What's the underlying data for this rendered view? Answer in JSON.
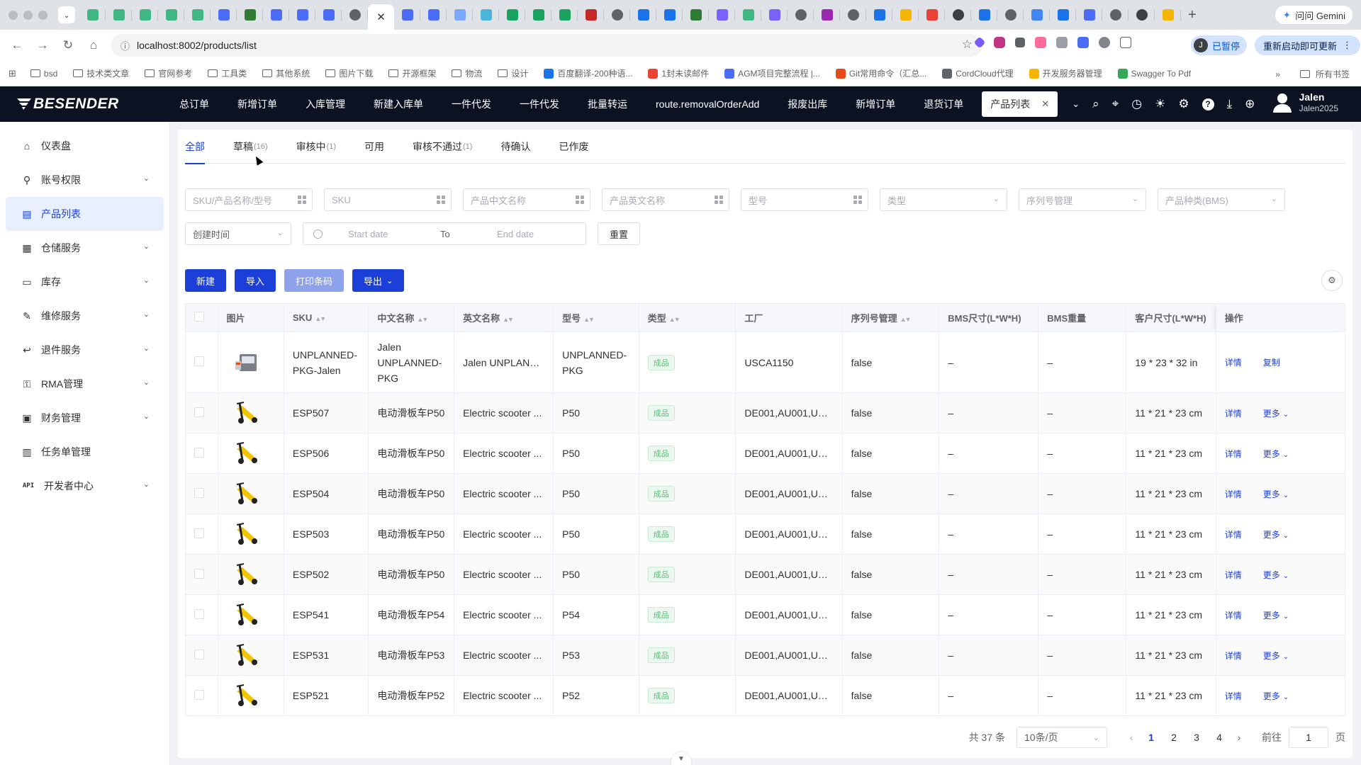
{
  "browser": {
    "url": "localhost:8002/products/list",
    "gemini_label": "问问 Gemini",
    "paused_avatar": "J",
    "paused_label": "已暂停",
    "restart_label": "重新启动即可更新",
    "bookmarks": [
      {
        "label": "bsd",
        "kind": "folder"
      },
      {
        "label": "技术类文章",
        "kind": "folder"
      },
      {
        "label": "官网参考",
        "kind": "folder"
      },
      {
        "label": "工具类",
        "kind": "folder"
      },
      {
        "label": "其他系统",
        "kind": "folder"
      },
      {
        "label": "图片下载",
        "kind": "folder"
      },
      {
        "label": "开源框架",
        "kind": "folder"
      },
      {
        "label": "物流",
        "kind": "folder"
      },
      {
        "label": "设计",
        "kind": "folder"
      },
      {
        "label": "百度翻译-200种语...",
        "kind": "site"
      },
      {
        "label": "1封未读邮件",
        "kind": "site"
      },
      {
        "label": "AGM项目完整流程 |...",
        "kind": "site"
      },
      {
        "label": "Git常用命令（汇总...",
        "kind": "site"
      },
      {
        "label": "CordCloud代理",
        "kind": "site"
      },
      {
        "label": "开发服务器管理",
        "kind": "site"
      },
      {
        "label": "Swagger To Pdf",
        "kind": "site"
      }
    ],
    "bookmarks_more": "»",
    "all_bookmarks": "所有书签"
  },
  "app": {
    "logo": "BESENDER",
    "tabs": [
      "总订单",
      "新增订单",
      "入库管理",
      "新建入库单",
      "一件代发",
      "一件代发",
      "批量转运",
      "route.removalOrderAdd",
      "报废出库",
      "新增订单",
      "退货订单"
    ],
    "active_tab": "产品列表",
    "user_name": "Jalen",
    "user_sub": "Jalen2025"
  },
  "sidebar": {
    "items": [
      {
        "label": "仪表盘",
        "icon": "home-icon",
        "glyph": "⌂",
        "chevron": false,
        "active": false
      },
      {
        "label": "账号权限",
        "icon": "user-key-icon",
        "glyph": "⚲",
        "chevron": true,
        "active": false
      },
      {
        "label": "产品列表",
        "icon": "document-icon",
        "glyph": "▤",
        "chevron": false,
        "active": true
      },
      {
        "label": "仓储服务",
        "icon": "warehouse-icon",
        "glyph": "▦",
        "chevron": true,
        "active": false
      },
      {
        "label": "库存",
        "icon": "box-icon",
        "glyph": "▭",
        "chevron": true,
        "active": false
      },
      {
        "label": "维修服务",
        "icon": "wrench-icon",
        "glyph": "✎",
        "chevron": true,
        "active": false
      },
      {
        "label": "退件服务",
        "icon": "return-icon",
        "glyph": "↩",
        "chevron": true,
        "active": false
      },
      {
        "label": "RMA管理",
        "icon": "lock-icon",
        "glyph": "⚿",
        "chevron": true,
        "active": false
      },
      {
        "label": "财务管理",
        "icon": "wallet-icon",
        "glyph": "▣",
        "chevron": true,
        "active": false
      },
      {
        "label": "任务单管理",
        "icon": "clipboard-icon",
        "glyph": "▥",
        "chevron": false,
        "active": false
      },
      {
        "label": "开发者中心",
        "icon": "api-icon",
        "glyph": "API",
        "chevron": true,
        "active": false
      }
    ]
  },
  "status_tabs": [
    {
      "label": "全部",
      "count": "",
      "active": true
    },
    {
      "label": "草稿",
      "count": "(16)",
      "active": false
    },
    {
      "label": "审核中",
      "count": "(1)",
      "active": false
    },
    {
      "label": "可用",
      "count": "",
      "active": false
    },
    {
      "label": "审核不通过",
      "count": "(1)",
      "active": false
    },
    {
      "label": "待确认",
      "count": "",
      "active": false
    },
    {
      "label": "已作废",
      "count": "",
      "active": false
    }
  ],
  "filters": {
    "sku_name_model": "SKU/产品名称/型号",
    "sku": "SKU",
    "cn_name": "产品中文名称",
    "en_name": "产品英文名称",
    "model": "型号",
    "type": "类型",
    "serial": "序列号管理",
    "bms_category": "产品种类(BMS)",
    "time_select": "创建时间",
    "start_date": "Start date",
    "to": "To",
    "end_date": "End date",
    "reset": "重置"
  },
  "actions": {
    "new": "新建",
    "import": "导入",
    "print": "打印条码",
    "export": "导出"
  },
  "table": {
    "headers": [
      "图片",
      "SKU",
      "中文名称",
      "英文名称",
      "型号",
      "类型",
      "工厂",
      "序列号管理",
      "BMS尺寸(L*W*H)",
      "BMS重量",
      "客户尺寸(L*W*H)",
      "操作"
    ],
    "detail_label": "详情",
    "copy_label": "复制",
    "more_label": "更多",
    "rows": [
      {
        "sku": "UNPLANNED-PKG-Jalen",
        "cn": "Jalen UNPLANNED-PKG",
        "en": "Jalen UNPLANN...",
        "model": "UNPLANNED-PKG",
        "type": "成品",
        "factory": "USCA1150",
        "serial": "false",
        "bms_size": "–",
        "bms_weight": "–",
        "cust_size": "19 * 23 * 32 in",
        "op2": "copy"
      },
      {
        "sku": "ESP507",
        "cn": "电动滑板车P50",
        "en": "Electric scooter ...",
        "model": "P50",
        "type": "成品",
        "factory": "DE001,AU001,USC...",
        "serial": "false",
        "bms_size": "–",
        "bms_weight": "–",
        "cust_size": "11 * 21 * 23 cm",
        "op2": "more"
      },
      {
        "sku": "ESP506",
        "cn": "电动滑板车P50",
        "en": "Electric scooter ...",
        "model": "P50",
        "type": "成品",
        "factory": "DE001,AU001,USC...",
        "serial": "false",
        "bms_size": "–",
        "bms_weight": "–",
        "cust_size": "11 * 21 * 23 cm",
        "op2": "more"
      },
      {
        "sku": "ESP504",
        "cn": "电动滑板车P50",
        "en": "Electric scooter ...",
        "model": "P50",
        "type": "成品",
        "factory": "DE001,AU001,USC...",
        "serial": "false",
        "bms_size": "–",
        "bms_weight": "–",
        "cust_size": "11 * 21 * 23 cm",
        "op2": "more"
      },
      {
        "sku": "ESP503",
        "cn": "电动滑板车P50",
        "en": "Electric scooter ...",
        "model": "P50",
        "type": "成品",
        "factory": "DE001,AU001,USC...",
        "serial": "false",
        "bms_size": "–",
        "bms_weight": "–",
        "cust_size": "11 * 21 * 23 cm",
        "op2": "more"
      },
      {
        "sku": "ESP502",
        "cn": "电动滑板车P50",
        "en": "Electric scooter ...",
        "model": "P50",
        "type": "成品",
        "factory": "DE001,AU001,USC...",
        "serial": "false",
        "bms_size": "–",
        "bms_weight": "–",
        "cust_size": "11 * 21 * 23 cm",
        "op2": "more"
      },
      {
        "sku": "ESP541",
        "cn": "电动滑板车P54",
        "en": "Electric scooter ...",
        "model": "P54",
        "type": "成品",
        "factory": "DE001,AU001,USC...",
        "serial": "false",
        "bms_size": "–",
        "bms_weight": "–",
        "cust_size": "11 * 21 * 23 cm",
        "op2": "more"
      },
      {
        "sku": "ESP531",
        "cn": "电动滑板车P53",
        "en": "Electric scooter ...",
        "model": "P53",
        "type": "成品",
        "factory": "DE001,AU001,USC...",
        "serial": "false",
        "bms_size": "–",
        "bms_weight": "–",
        "cust_size": "11 * 21 * 23 cm",
        "op2": "more"
      },
      {
        "sku": "ESP521",
        "cn": "电动滑板车P52",
        "en": "Electric scooter ...",
        "model": "P52",
        "type": "成品",
        "factory": "DE001,AU001,USC...",
        "serial": "false",
        "bms_size": "–",
        "bms_weight": "–",
        "cust_size": "11 * 21 * 23 cm",
        "op2": "more"
      }
    ]
  },
  "pagination": {
    "total": "共 37 条",
    "page_size": "10条/页",
    "pages": [
      "1",
      "2",
      "3",
      "4"
    ],
    "current": "1",
    "goto_label": "前往",
    "goto_value": "1",
    "page_unit": "页"
  },
  "colors": {
    "accent": "#1c3fd8",
    "header_bg": "#0c1222",
    "tag_green": "#5fb878"
  }
}
